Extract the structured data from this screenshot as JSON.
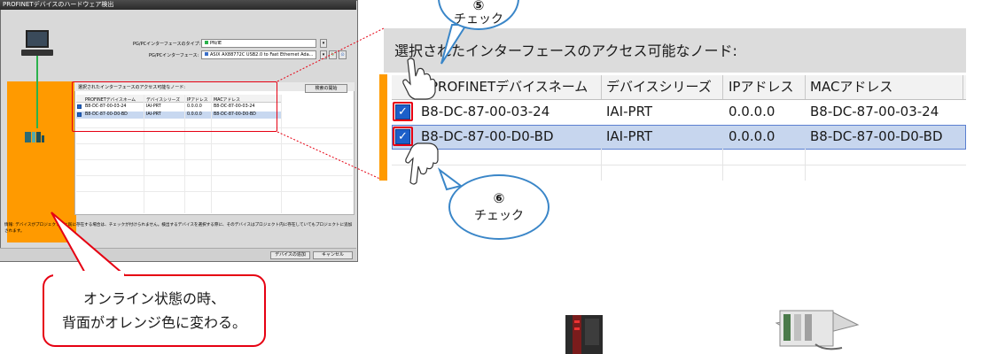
{
  "dialog": {
    "title": "PROFINETデバイスのハードウェア検出",
    "close_glyph": "×",
    "interface_type_label": "PG/PCインターフェースのタイプ:",
    "interface_type_value": "PN/IE",
    "interface_label": "PG/PCインターフェース:",
    "interface_value": "ASIX AX88772C USB2.0 to Fast Ethernet Ada...",
    "nodes_label": "選択されたインターフェースのアクセス可能なノード:",
    "search_button": "検索の開始",
    "table": {
      "columns": [
        "PROFINETデバイスネーム",
        "デバイスシリーズ",
        "IPアドレス",
        "MACアドレス"
      ],
      "rows": [
        {
          "checked": true,
          "name": "B8-DC-87-00-03-24",
          "series": "IAI-PRT",
          "ip": "0.0.0.0",
          "mac": "B8-DC-87-00-03-24",
          "selected": false
        },
        {
          "checked": true,
          "name": "B8-DC-87-00-D0-BD",
          "series": "IAI-PRT",
          "ip": "0.0.0.0",
          "mac": "B8-DC-87-00-D0-BD",
          "selected": true
        }
      ]
    },
    "info_text": "情報: デバイスがプロジェクト内に既に存在する場合は、チェックが付けられません。検出するデバイスを選択する際に、そのデバイスはプロジェクト内に存在していてもプロジェクトに追加されます。",
    "add_device_button": "デバイスの追加",
    "cancel_button": "キャンセル"
  },
  "zoom": {
    "title": "選択されたインターフェースのアクセス可能なノード:",
    "columns": [
      "PROFINETデバイスネーム",
      "デバイスシリーズ",
      "IPアドレス",
      "MACアドレス"
    ],
    "rows": [
      {
        "checked": true,
        "name": "B8-DC-87-00-03-24",
        "series": "IAI-PRT",
        "ip": "0.0.0.0",
        "mac": "B8-DC-87-00-03-24",
        "selected": false
      },
      {
        "checked": true,
        "name": "B8-DC-87-00-D0-BD",
        "series": "IAI-PRT",
        "ip": "0.0.0.0",
        "mac": "B8-DC-87-00-D0-BD",
        "selected": true
      }
    ]
  },
  "callouts": {
    "step5": {
      "number": "⑤",
      "text": "チェック"
    },
    "step6": {
      "number": "⑥",
      "text": "チェック"
    },
    "note_line1": "オンライン状態の時、",
    "note_line2": "背面がオレンジ色に変わる。"
  },
  "colors": {
    "orange": "#ff9a00",
    "red": "#e60012",
    "blue": "#3a86c8",
    "selection": "#c7d6ee"
  }
}
